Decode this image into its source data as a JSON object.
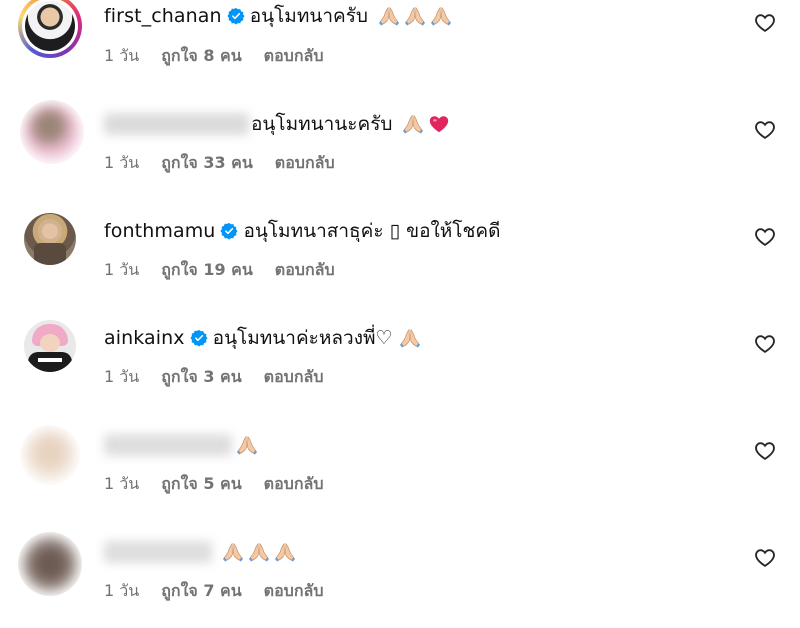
{
  "comments": [
    {
      "username": "first_chanan",
      "verified": true,
      "text": "อนุโมทนาครับ",
      "emoji": [
        "folded-hands-emoji",
        "folded-hands-emoji",
        "folded-hands-emoji"
      ],
      "time": "1 วัน",
      "likes": "ถูกใจ 8 คน",
      "reply": "ตอบกลับ"
    },
    {
      "username": "",
      "verified": false,
      "text": "อนุโมทนานะครับ",
      "emoji": [
        "folded-hands-emoji",
        "red-heart-emoji"
      ],
      "time": "1 วัน",
      "likes": "ถูกใจ 33 คน",
      "reply": "ตอบกลับ"
    },
    {
      "username": "fonthmamu",
      "verified": true,
      "text": "อนุโมทนาสาธุค่ะ ▯ ขอให้โชคดี",
      "emoji": [],
      "time": "1 วัน",
      "likes": "ถูกใจ 19 คน",
      "reply": "ตอบกลับ"
    },
    {
      "username": "ainkainx",
      "verified": true,
      "text": "อนุโมทนาค่ะหลวงพี่♡",
      "emoji": [
        "folded-hands-emoji"
      ],
      "time": "1 วัน",
      "likes": "ถูกใจ 3 คน",
      "reply": "ตอบกลับ"
    },
    {
      "username": "",
      "verified": false,
      "text": "",
      "emoji": [
        "folded-hands-emoji"
      ],
      "time": "1 วัน",
      "likes": "ถูกใจ 5 คน",
      "reply": "ตอบกลับ"
    },
    {
      "username": "",
      "verified": false,
      "text": "",
      "emoji": [
        "folded-hands-emoji",
        "folded-hands-emoji",
        "folded-hands-emoji"
      ],
      "time": "1 วัน",
      "likes": "ถูกใจ 7 คน",
      "reply": "ตอบกลับ"
    }
  ],
  "colors": {
    "text": "#111111",
    "meta": "#737373",
    "verified": "#0095f6",
    "heart": "#262626"
  },
  "icons": {
    "verified": "verified-badge-icon",
    "like": "heart-outline-icon"
  }
}
